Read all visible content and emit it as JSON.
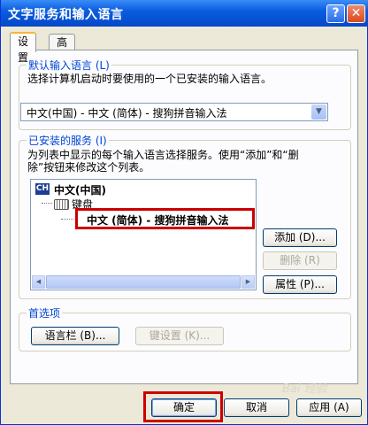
{
  "window": {
    "title": "文字服务和输入语言",
    "help_icon": "?",
    "close_icon": "✕"
  },
  "tabs": [
    {
      "label": "设置"
    },
    {
      "label": "高级"
    }
  ],
  "default_language": {
    "group_label": "默认输入语言 (L)",
    "description": "选择计算机启动时要使用的一个已安装的输入语言。",
    "selected": "中文(中国) - 中文 (简体) - 搜狗拼音输入法"
  },
  "installed_services": {
    "group_label": "已安装的服务 (I)",
    "description_line1": "为列表中显示的每个输入语言选择服务。使用“添加”和“删",
    "description_line2": "除”按钮来修改这个列表。",
    "lang_badge": "CH",
    "language": "中文(中国)",
    "category": "键盘",
    "service": "中文 (简体) - 搜狗拼音输入法",
    "add_button": "添加 (D)...",
    "remove_button": "删除 (R)",
    "properties_button": "属性 (P)..."
  },
  "preferences": {
    "group_label": "首选项",
    "language_bar_button": "语言栏 (B)...",
    "key_settings_button": "键设置 (K)..."
  },
  "footer": {
    "ok": "确定",
    "cancel": "取消",
    "apply": "应用 (A)"
  },
  "watermark": "Bai 经验",
  "colors": {
    "highlight": "#cc0000",
    "title_bar": "#0a5de0"
  }
}
